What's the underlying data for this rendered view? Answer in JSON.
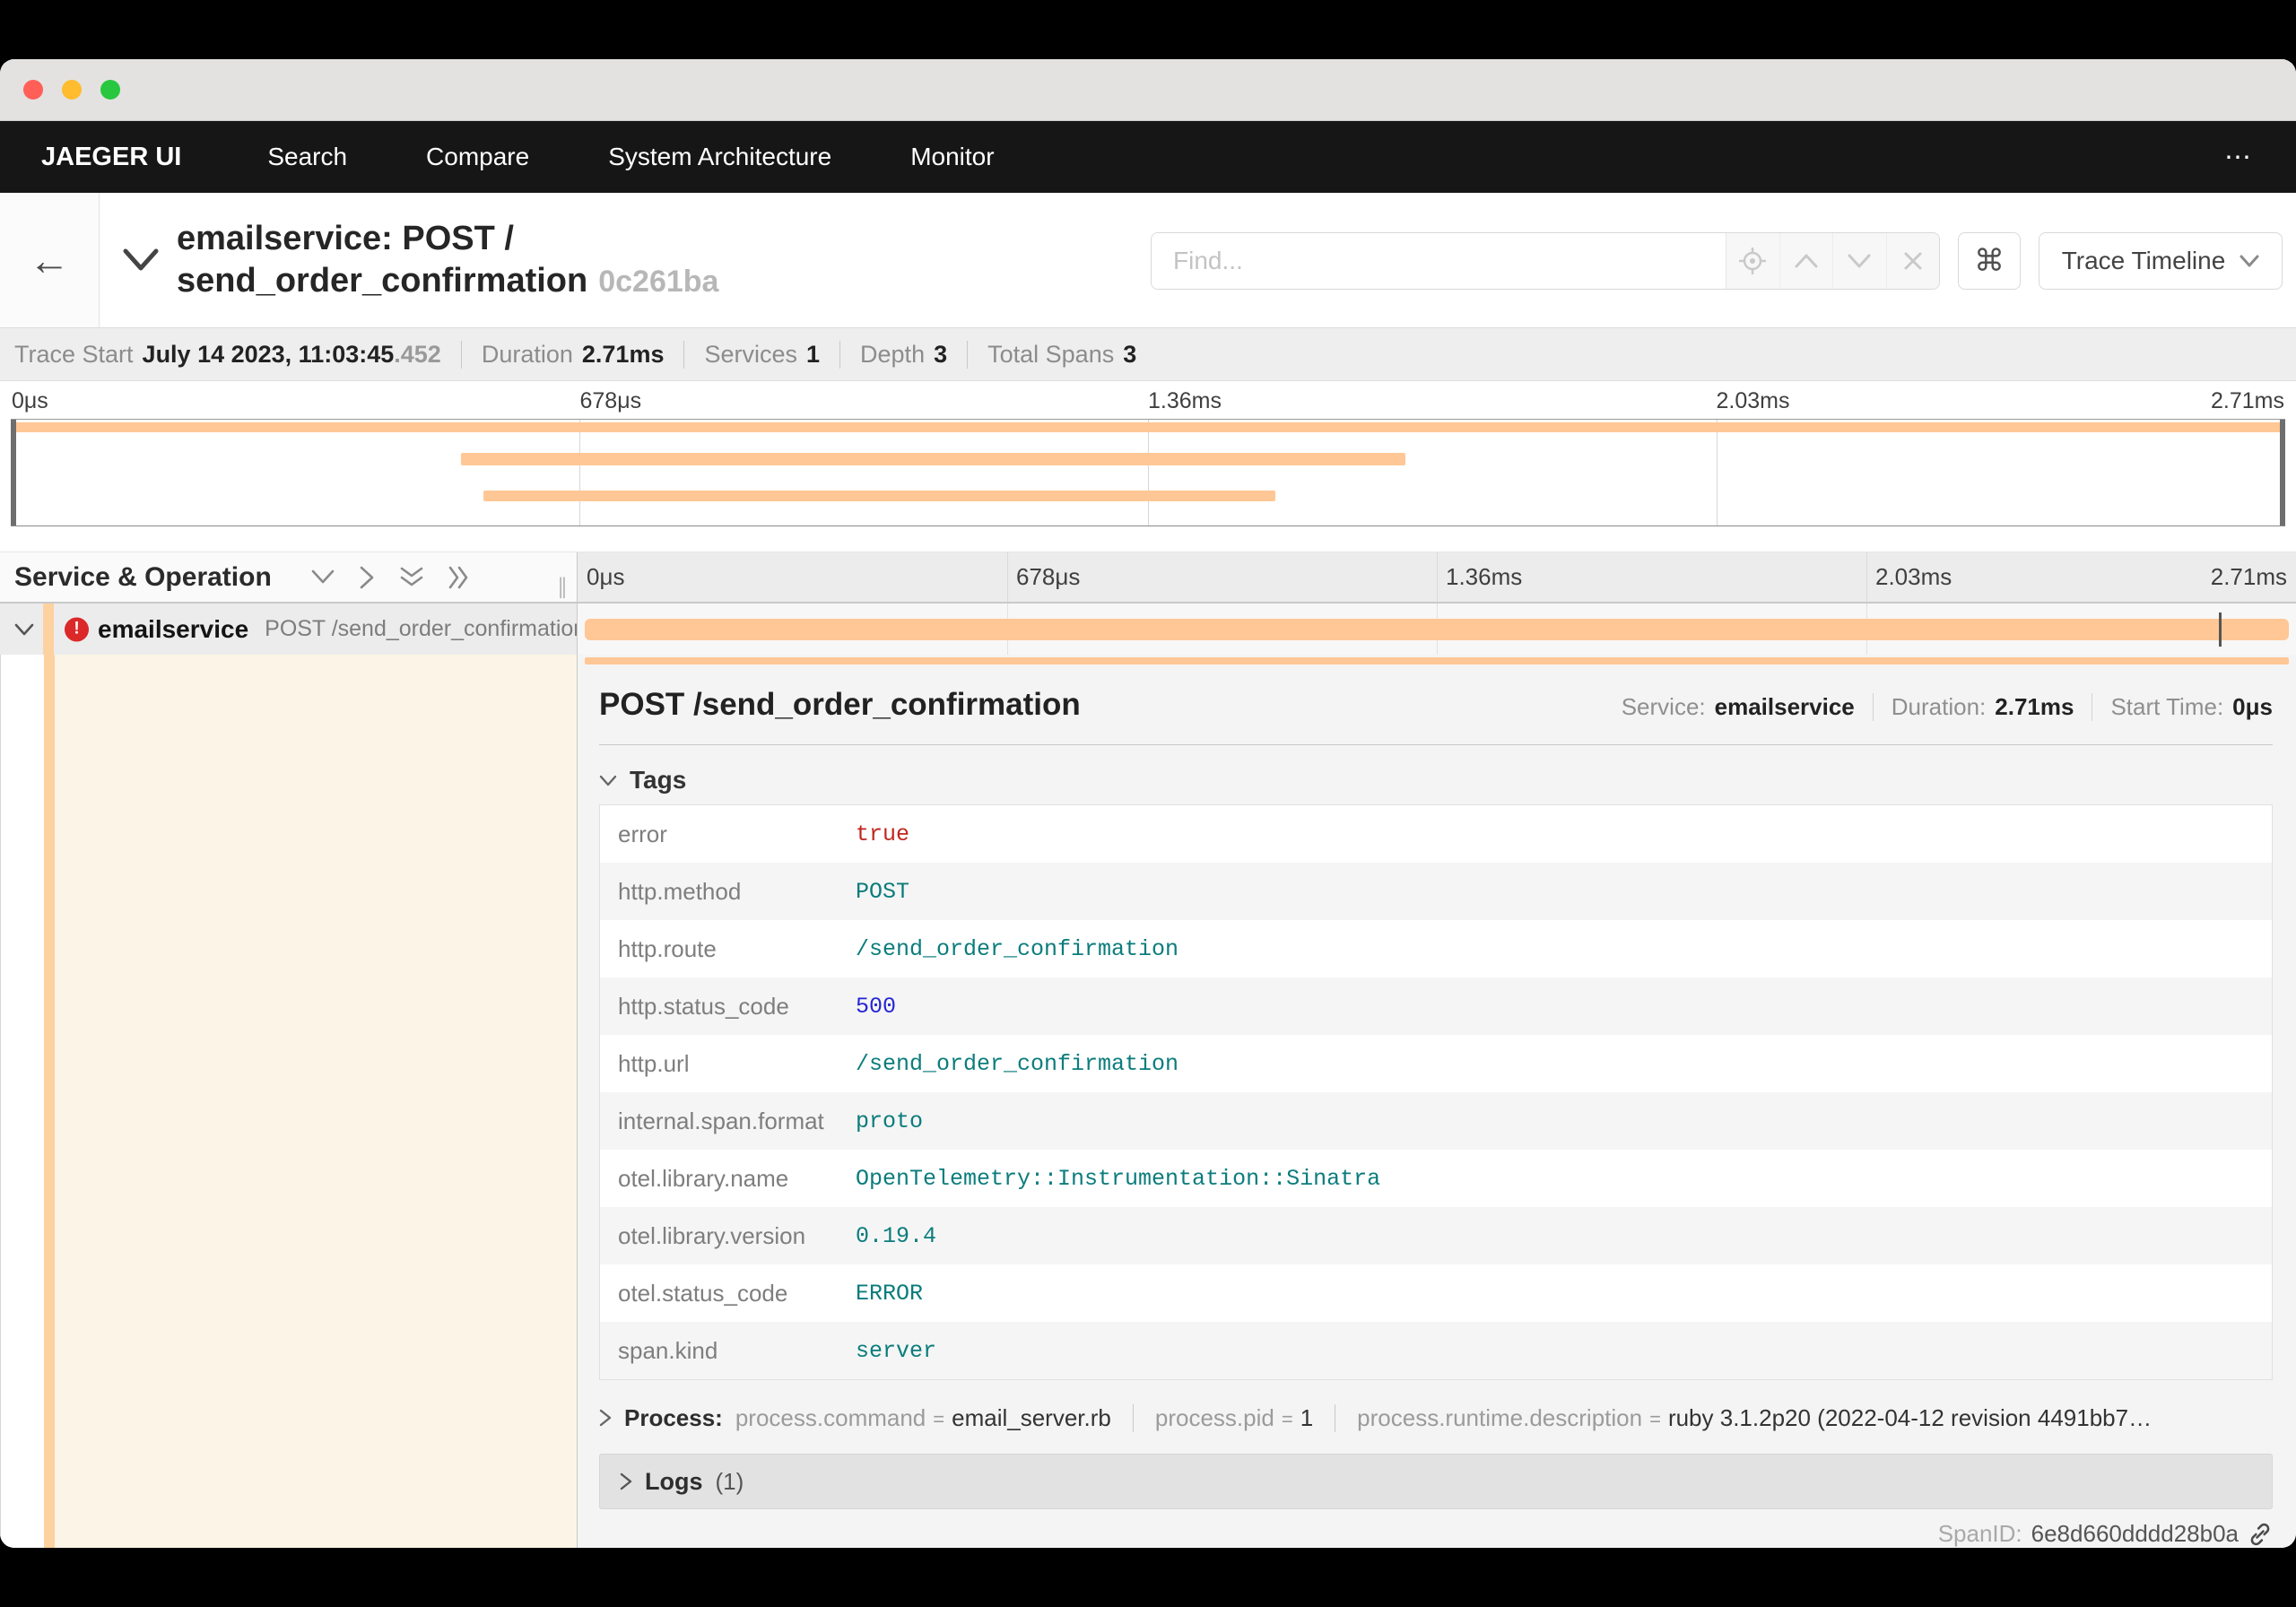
{
  "navbar": {
    "brand": "JAEGER UI",
    "items": [
      "Search",
      "Compare",
      "System Architecture",
      "Monitor"
    ],
    "overflow": "⋯"
  },
  "trace_header": {
    "back_glyph": "←",
    "title_line1": "emailservice: POST /",
    "title_line2": "send_order_confirmation",
    "trace_id": "0c261ba",
    "find_placeholder": "Find...",
    "command_glyph": "⌘",
    "view_selector": "Trace Timeline"
  },
  "summary": {
    "items": [
      {
        "label": "Trace Start",
        "value": "July 14 2023, 11:03:45",
        "suffix": ".452"
      },
      {
        "label": "Duration",
        "value": "2.71ms"
      },
      {
        "label": "Services",
        "value": "1"
      },
      {
        "label": "Depth",
        "value": "3"
      },
      {
        "label": "Total Spans",
        "value": "3"
      }
    ]
  },
  "timeline": {
    "ticks": [
      "0μs",
      "678μs",
      "1.36ms",
      "2.03ms",
      "2.71ms"
    ],
    "minimap_bars": [
      {
        "left": "0%",
        "width": "100%"
      },
      {
        "left": "19.8%",
        "width": "41.5%"
      },
      {
        "left": "20.8%",
        "width": "34.8%"
      }
    ],
    "span_bar": {
      "left": "0.4%",
      "width": "99.2%"
    },
    "log_marker_left": "95.5%"
  },
  "span_tree": {
    "header": "Service & Operation",
    "row": {
      "service": "emailservice",
      "operation": "POST /send_order_confirmation",
      "error_glyph": "!"
    }
  },
  "detail": {
    "title": "POST /send_order_confirmation",
    "meta": [
      {
        "label": "Service:",
        "value": "emailservice"
      },
      {
        "label": "Duration:",
        "value": "2.71ms"
      },
      {
        "label": "Start Time:",
        "value": "0μs"
      }
    ],
    "tags_header": "Tags",
    "tags": [
      {
        "key": "error",
        "value": "true",
        "vtype": "bool"
      },
      {
        "key": "http.method",
        "value": "POST",
        "vtype": "string"
      },
      {
        "key": "http.route",
        "value": "/send_order_confirmation",
        "vtype": "string"
      },
      {
        "key": "http.status_code",
        "value": "500",
        "vtype": "number"
      },
      {
        "key": "http.url",
        "value": "/send_order_confirmation",
        "vtype": "string"
      },
      {
        "key": "internal.span.format",
        "value": "proto",
        "vtype": "string"
      },
      {
        "key": "otel.library.name",
        "value": "OpenTelemetry::Instrumentation::Sinatra",
        "vtype": "string"
      },
      {
        "key": "otel.library.version",
        "value": "0.19.4",
        "vtype": "string"
      },
      {
        "key": "otel.status_code",
        "value": "ERROR",
        "vtype": "string"
      },
      {
        "key": "span.kind",
        "value": "server",
        "vtype": "string"
      }
    ],
    "process": {
      "label": "Process:",
      "eq": "=",
      "items": [
        {
          "key": "process.command",
          "value": "email_server.rb"
        },
        {
          "key": "process.pid",
          "value": "1"
        },
        {
          "key": "process.runtime.description",
          "value": "ruby 3.1.2p20 (2022-04-12 revision 4491bb7…"
        }
      ]
    },
    "logs": {
      "label": "Logs",
      "count": "(1)"
    },
    "span_id": {
      "label": "SpanID:",
      "value": "6e8d660dddd28b0a"
    }
  },
  "colors": {
    "accent_orange": "#ffc795",
    "error_red": "#db2828",
    "value_teal": "#0b7c7c",
    "value_red": "#c0261f",
    "value_blue": "#2525d5",
    "navbar_bg": "#161616"
  }
}
